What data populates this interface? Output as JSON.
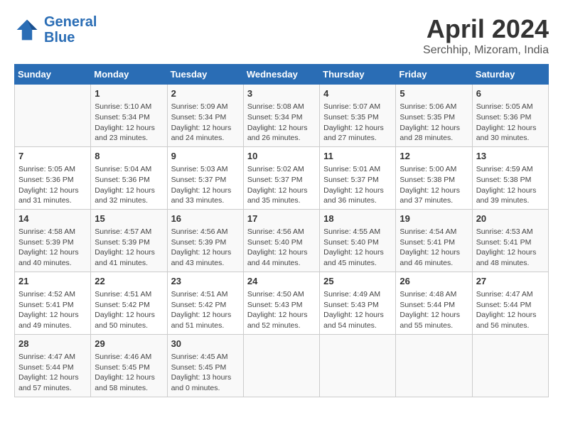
{
  "logo": {
    "line1": "General",
    "line2": "Blue"
  },
  "title": "April 2024",
  "subtitle": "Serchhip, Mizoram, India",
  "headers": [
    "Sunday",
    "Monday",
    "Tuesday",
    "Wednesday",
    "Thursday",
    "Friday",
    "Saturday"
  ],
  "weeks": [
    [
      {
        "day": "",
        "info": ""
      },
      {
        "day": "1",
        "info": "Sunrise: 5:10 AM\nSunset: 5:34 PM\nDaylight: 12 hours\nand 23 minutes."
      },
      {
        "day": "2",
        "info": "Sunrise: 5:09 AM\nSunset: 5:34 PM\nDaylight: 12 hours\nand 24 minutes."
      },
      {
        "day": "3",
        "info": "Sunrise: 5:08 AM\nSunset: 5:34 PM\nDaylight: 12 hours\nand 26 minutes."
      },
      {
        "day": "4",
        "info": "Sunrise: 5:07 AM\nSunset: 5:35 PM\nDaylight: 12 hours\nand 27 minutes."
      },
      {
        "day": "5",
        "info": "Sunrise: 5:06 AM\nSunset: 5:35 PM\nDaylight: 12 hours\nand 28 minutes."
      },
      {
        "day": "6",
        "info": "Sunrise: 5:05 AM\nSunset: 5:36 PM\nDaylight: 12 hours\nand 30 minutes."
      }
    ],
    [
      {
        "day": "7",
        "info": "Sunrise: 5:05 AM\nSunset: 5:36 PM\nDaylight: 12 hours\nand 31 minutes."
      },
      {
        "day": "8",
        "info": "Sunrise: 5:04 AM\nSunset: 5:36 PM\nDaylight: 12 hours\nand 32 minutes."
      },
      {
        "day": "9",
        "info": "Sunrise: 5:03 AM\nSunset: 5:37 PM\nDaylight: 12 hours\nand 33 minutes."
      },
      {
        "day": "10",
        "info": "Sunrise: 5:02 AM\nSunset: 5:37 PM\nDaylight: 12 hours\nand 35 minutes."
      },
      {
        "day": "11",
        "info": "Sunrise: 5:01 AM\nSunset: 5:37 PM\nDaylight: 12 hours\nand 36 minutes."
      },
      {
        "day": "12",
        "info": "Sunrise: 5:00 AM\nSunset: 5:38 PM\nDaylight: 12 hours\nand 37 minutes."
      },
      {
        "day": "13",
        "info": "Sunrise: 4:59 AM\nSunset: 5:38 PM\nDaylight: 12 hours\nand 39 minutes."
      }
    ],
    [
      {
        "day": "14",
        "info": "Sunrise: 4:58 AM\nSunset: 5:39 PM\nDaylight: 12 hours\nand 40 minutes."
      },
      {
        "day": "15",
        "info": "Sunrise: 4:57 AM\nSunset: 5:39 PM\nDaylight: 12 hours\nand 41 minutes."
      },
      {
        "day": "16",
        "info": "Sunrise: 4:56 AM\nSunset: 5:39 PM\nDaylight: 12 hours\nand 43 minutes."
      },
      {
        "day": "17",
        "info": "Sunrise: 4:56 AM\nSunset: 5:40 PM\nDaylight: 12 hours\nand 44 minutes."
      },
      {
        "day": "18",
        "info": "Sunrise: 4:55 AM\nSunset: 5:40 PM\nDaylight: 12 hours\nand 45 minutes."
      },
      {
        "day": "19",
        "info": "Sunrise: 4:54 AM\nSunset: 5:41 PM\nDaylight: 12 hours\nand 46 minutes."
      },
      {
        "day": "20",
        "info": "Sunrise: 4:53 AM\nSunset: 5:41 PM\nDaylight: 12 hours\nand 48 minutes."
      }
    ],
    [
      {
        "day": "21",
        "info": "Sunrise: 4:52 AM\nSunset: 5:41 PM\nDaylight: 12 hours\nand 49 minutes."
      },
      {
        "day": "22",
        "info": "Sunrise: 4:51 AM\nSunset: 5:42 PM\nDaylight: 12 hours\nand 50 minutes."
      },
      {
        "day": "23",
        "info": "Sunrise: 4:51 AM\nSunset: 5:42 PM\nDaylight: 12 hours\nand 51 minutes."
      },
      {
        "day": "24",
        "info": "Sunrise: 4:50 AM\nSunset: 5:43 PM\nDaylight: 12 hours\nand 52 minutes."
      },
      {
        "day": "25",
        "info": "Sunrise: 4:49 AM\nSunset: 5:43 PM\nDaylight: 12 hours\nand 54 minutes."
      },
      {
        "day": "26",
        "info": "Sunrise: 4:48 AM\nSunset: 5:44 PM\nDaylight: 12 hours\nand 55 minutes."
      },
      {
        "day": "27",
        "info": "Sunrise: 4:47 AM\nSunset: 5:44 PM\nDaylight: 12 hours\nand 56 minutes."
      }
    ],
    [
      {
        "day": "28",
        "info": "Sunrise: 4:47 AM\nSunset: 5:44 PM\nDaylight: 12 hours\nand 57 minutes."
      },
      {
        "day": "29",
        "info": "Sunrise: 4:46 AM\nSunset: 5:45 PM\nDaylight: 12 hours\nand 58 minutes."
      },
      {
        "day": "30",
        "info": "Sunrise: 4:45 AM\nSunset: 5:45 PM\nDaylight: 13 hours\nand 0 minutes."
      },
      {
        "day": "",
        "info": ""
      },
      {
        "day": "",
        "info": ""
      },
      {
        "day": "",
        "info": ""
      },
      {
        "day": "",
        "info": ""
      }
    ]
  ]
}
